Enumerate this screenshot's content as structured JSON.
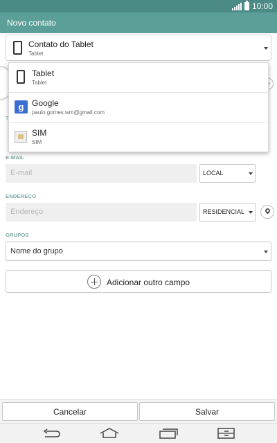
{
  "status_bar": {
    "time": "10:00"
  },
  "header": {
    "title": "Novo contato"
  },
  "account_selector": {
    "name": "Contato do Tablet",
    "subtitle": "Tablet"
  },
  "account_dropdown": {
    "items": [
      {
        "name": "Tablet",
        "subtitle": "Tablet",
        "icon": "tablet-icon"
      },
      {
        "name": "Google",
        "subtitle": "paulo.gomes.wm@gmail.com",
        "icon": "google-icon"
      },
      {
        "name": "SIM",
        "subtitle": "SIM",
        "icon": "sim-card-icon"
      }
    ]
  },
  "email_section": {
    "label": "E-MAIL",
    "placeholder": "E-mail",
    "type": "LOCAL"
  },
  "address_section": {
    "label": "ENDEREÇO",
    "placeholder": "Endereço",
    "type": "RESIDENCIAL"
  },
  "groups_section": {
    "label": "GRUPOS",
    "value": "Nome do grupo"
  },
  "add_field": {
    "label": "Adicionar outro campo"
  },
  "actions": {
    "cancel": "Cancelar",
    "save": "Salvar"
  },
  "colors": {
    "status_bar": "#4b8a85",
    "action_bar": "#5b9f98",
    "section_label": "#7aa6a1",
    "google_blue": "#3b6fd4"
  }
}
